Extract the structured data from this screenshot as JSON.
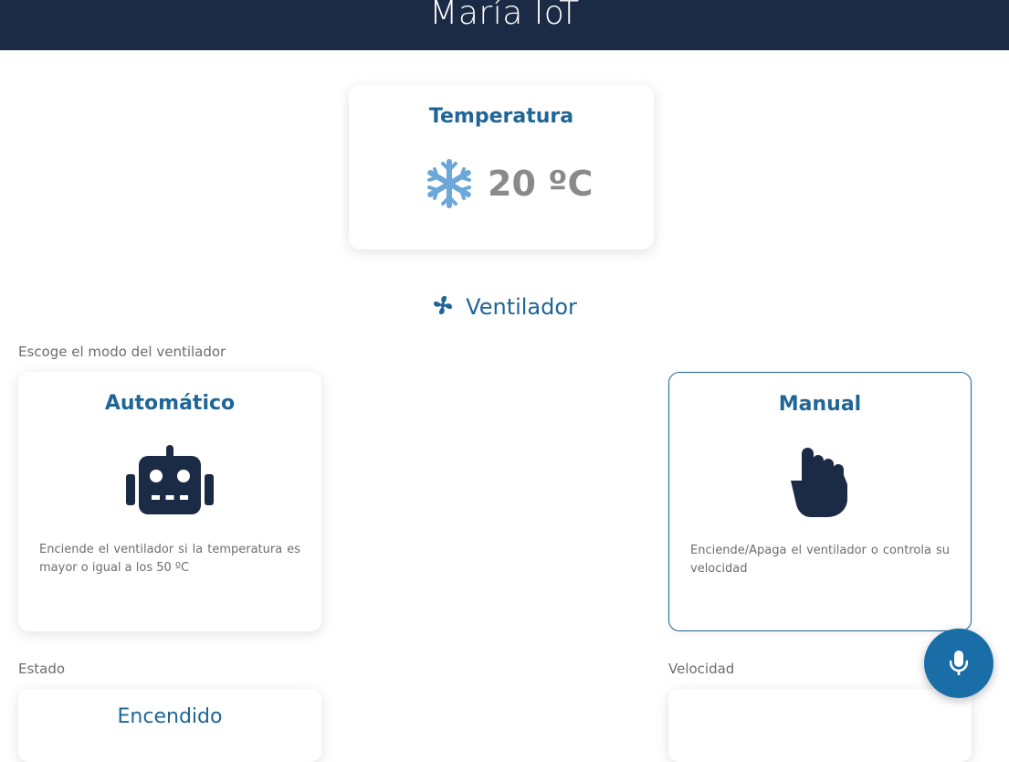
{
  "app": {
    "title": "María IoT"
  },
  "temperature": {
    "title": "Temperatura",
    "value": "20 ºC",
    "icon": "snowflake-icon",
    "icon_color": "#6ba7d8"
  },
  "fan_section": {
    "title": "Ventilador",
    "icon": "fan-icon",
    "mode_label": "Escoge el modo del ventilador",
    "modes": [
      {
        "title": "Automático",
        "icon": "robot-icon",
        "description": "Enciende el ventilador si la temperatura es mayor o igual a los 50 ºC",
        "selected": false
      },
      {
        "title": "Manual",
        "icon": "hand-pointer-icon",
        "description": "Enciende/Apaga el ventilador o controla su velocidad",
        "selected": true
      }
    ],
    "state_label": "Estado",
    "state_value": "Encendido",
    "speed_label": "Velocidad"
  },
  "voice": {
    "icon": "microphone-icon"
  },
  "colors": {
    "header_bg": "#1c2b45",
    "accent": "#1f6596",
    "mic_bg": "#1a6ea8",
    "icon_dark": "#1c2b45",
    "muted_text": "#6d6d6d"
  }
}
